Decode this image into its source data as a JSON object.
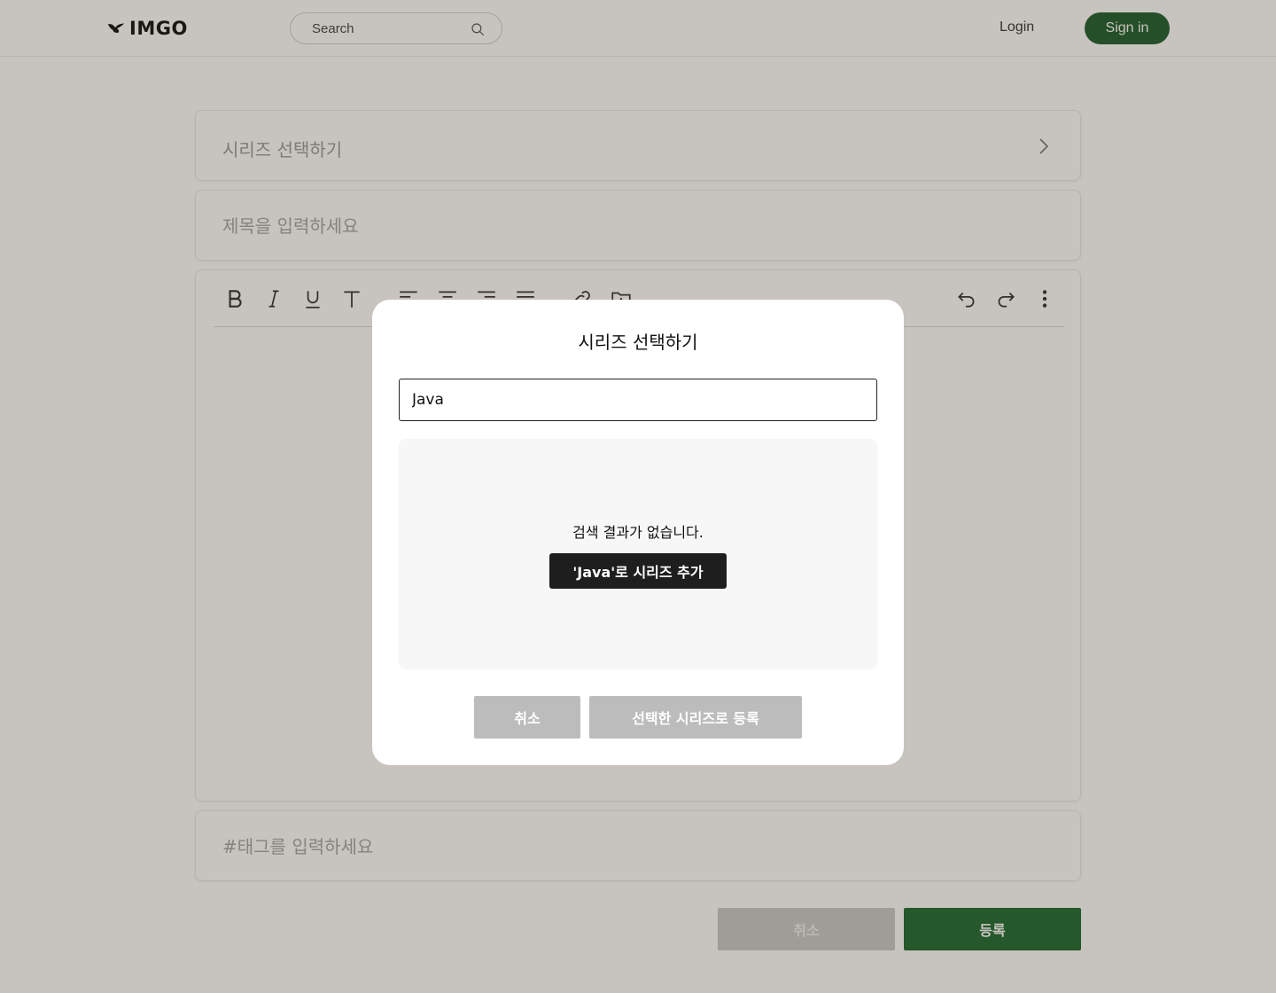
{
  "header": {
    "logo_text": "IMGO",
    "search_placeholder": "Search",
    "login_label": "Login",
    "signin_label": "Sign in"
  },
  "editor": {
    "series_placeholder": "시리즈 선택하기",
    "title_placeholder": "제목을 입력하세요",
    "tag_placeholder": "#태그를 입력하세요",
    "toolbar_left": [
      "bold-icon",
      "italic-icon",
      "underline-icon",
      "text-size-icon",
      "align-left-icon",
      "align-center-icon",
      "align-right-icon",
      "align-justify-icon",
      "link-icon",
      "folder-add-icon"
    ],
    "toolbar_right": [
      "undo-icon",
      "redo-icon",
      "more-vertical-icon"
    ],
    "cancel_label": "취소",
    "submit_label": "등록"
  },
  "modal": {
    "title": "시리즈 선택하기",
    "search_value": "Java",
    "empty_text": "검색 결과가 없습니다.",
    "add_label": "'Java'로 시리즈 추가",
    "cancel_label": "취소",
    "register_label": "선택한 시리즈로 등록"
  },
  "colors": {
    "brand_green": "#1f5f2f",
    "overlay": "rgba(54, 40, 26, 0.28)",
    "disabled_button": "#bcbcbc",
    "dark_button": "#1e1e1e"
  }
}
